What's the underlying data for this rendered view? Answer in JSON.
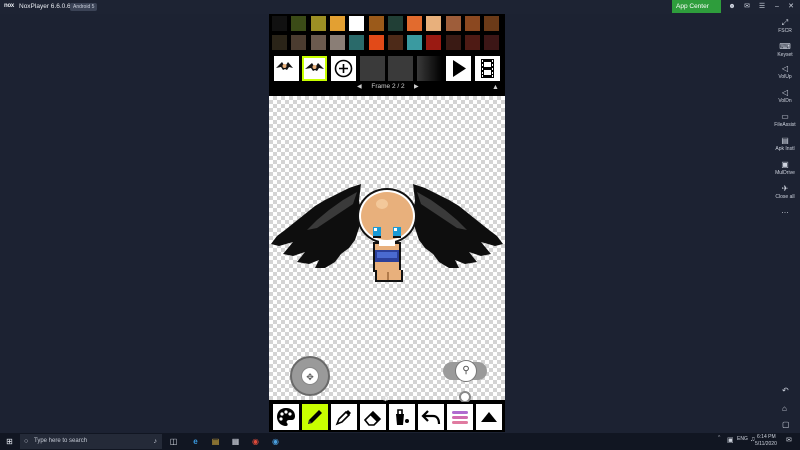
{
  "titlebar": {
    "logo_text": "nox",
    "title": "NoxPlayer 6.6.0.6",
    "android_badge": "Android 5",
    "app_center": "App Center",
    "colors": {
      "app_center_bg": "#2e9d3c"
    }
  },
  "sidebar": {
    "items": [
      {
        "label": "FSCR",
        "icon": "fullscreen-icon"
      },
      {
        "label": "Keyset",
        "icon": "keyboard-icon"
      },
      {
        "label": "VolUp",
        "icon": "volume-up-icon"
      },
      {
        "label": "VolDn",
        "icon": "volume-down-icon"
      },
      {
        "label": "FileAssist",
        "icon": "monitor-icon"
      },
      {
        "label": "Apk Instl",
        "icon": "apk-icon"
      },
      {
        "label": "MulDrive",
        "icon": "drive-icon"
      },
      {
        "label": "Close all",
        "icon": "rocket-icon"
      },
      {
        "label": "...",
        "icon": "more-icon"
      }
    ]
  },
  "app": {
    "palette": [
      [
        "#111111",
        "#3b4b17",
        "#9c8f24",
        "#e3a032",
        "#ffffff",
        "#9b5a1a",
        "#213f36",
        "#e26b2e",
        "#e8b07c",
        "#9e5d3a",
        "#8b4820",
        "#6b3a18"
      ],
      [
        "#2a2418",
        "#4b3c30",
        "#6b5a4e",
        "#8a7e76",
        "#2a6a6a",
        "#e24a18",
        "#4d2a18",
        "#3a9aa0",
        "#9a1a12",
        "#3a1a14",
        "#4e1a14",
        "#3c1616"
      ]
    ],
    "frame_label": "Frame 2 / 2",
    "colors": {
      "active_tool": "#c8ff00",
      "checker": "#d4d4d4"
    }
  },
  "taskbar": {
    "search_placeholder": "Type here to search",
    "lang": "ENG",
    "time": "6:14 PM",
    "date": "5/11/2020"
  }
}
